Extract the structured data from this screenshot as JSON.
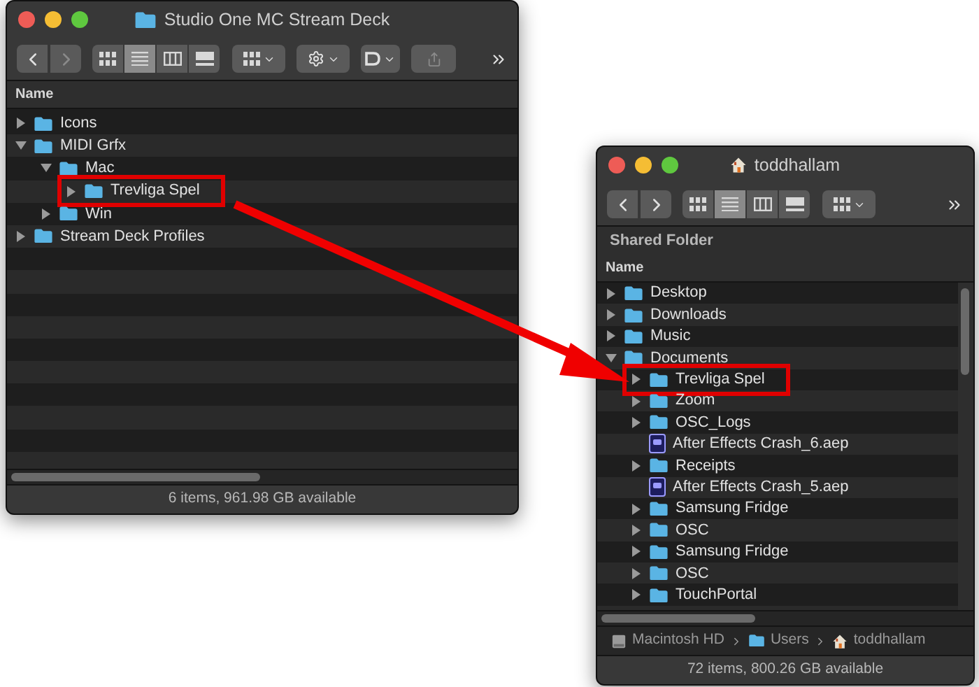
{
  "windows": [
    {
      "title": "Studio One MC Stream Deck",
      "forward_disabled": true,
      "toolbar": [
        {
          "kind": "view_icons",
          "selected": false
        },
        {
          "kind": "view_list",
          "selected": true
        },
        {
          "kind": "view_columns",
          "selected": false
        },
        {
          "kind": "view_gallery",
          "selected": false
        }
      ],
      "column": "Name",
      "rows": [
        {
          "name": "Icons",
          "kind": "folder",
          "expanded": false,
          "highlighted": false
        },
        {
          "name": "MIDI Grfx",
          "kind": "folder",
          "expanded": true,
          "highlighted": false,
          "children": [
            {
              "name": "Mac",
              "kind": "folder",
              "expanded": true,
              "highlighted": false,
              "children": [
                {
                  "name": "Trevliga Spel",
                  "kind": "folder",
                  "expanded": false,
                  "highlighted": true
                }
              ]
            },
            {
              "name": "Win",
              "kind": "folder",
              "expanded": false,
              "highlighted": false
            }
          ]
        },
        {
          "name": "Stream Deck Profiles",
          "kind": "folder",
          "expanded": false,
          "highlighted": false
        }
      ],
      "status": "6 items, 961.98 GB available"
    },
    {
      "title": "toddhallam",
      "forward_disabled": false,
      "toolbar": [
        {
          "kind": "view_icons",
          "selected": false
        },
        {
          "kind": "view_list",
          "selected": true
        },
        {
          "kind": "view_columns",
          "selected": false
        },
        {
          "kind": "view_gallery",
          "selected": false
        }
      ],
      "header": "Shared Folder",
      "column": "Name",
      "rows": [
        {
          "name": "Desktop",
          "kind": "folder",
          "expanded": false,
          "highlighted": false
        },
        {
          "name": "Downloads",
          "kind": "folder",
          "expanded": false,
          "highlighted": false
        },
        {
          "name": "Music",
          "kind": "folder",
          "expanded": false,
          "highlighted": false
        },
        {
          "name": "Documents",
          "kind": "folder",
          "expanded": true,
          "highlighted": false,
          "children": [
            {
              "name": "Trevliga Spel",
              "kind": "folder",
              "expanded": false,
              "highlighted": true
            },
            {
              "name": "Zoom",
              "kind": "folder",
              "expanded": false,
              "highlighted": false
            },
            {
              "name": "OSC_Logs",
              "kind": "folder",
              "expanded": false,
              "highlighted": false
            },
            {
              "name": "After Effects Crash_6.aep",
              "kind": "file",
              "highlighted": false
            },
            {
              "name": "Receipts",
              "kind": "folder",
              "expanded": false,
              "highlighted": false
            },
            {
              "name": "After Effects Crash_5.aep",
              "kind": "file",
              "highlighted": false
            },
            {
              "name": "Samsung Fridge",
              "kind": "folder",
              "expanded": false,
              "highlighted": false
            },
            {
              "name": "OSC",
              "kind": "folder",
              "expanded": false,
              "highlighted": false
            },
            {
              "name": "Samsung Fridge",
              "kind": "folder",
              "expanded": false,
              "highlighted": false
            },
            {
              "name": "OSC",
              "kind": "folder",
              "expanded": false,
              "highlighted": false
            },
            {
              "name": "TouchPortal",
              "kind": "folder",
              "expanded": false,
              "highlighted": false
            }
          ]
        }
      ],
      "path": [
        {
          "name": "Macintosh HD",
          "kind": "disk"
        },
        {
          "name": "Users",
          "kind": "folder"
        },
        {
          "name": "toddhallam",
          "kind": "home"
        }
      ],
      "status": "72 items, 800.26 GB available"
    }
  ]
}
